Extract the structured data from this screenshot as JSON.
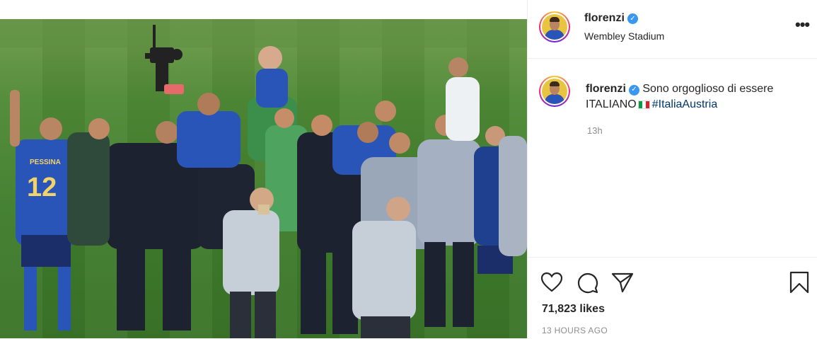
{
  "post": {
    "username": "florenzi",
    "location": "Wembley Stadium",
    "verified_badge": "✓",
    "more_icon": "•••",
    "caption_text": "Sono orgoglioso di essere ITALIANO",
    "caption_hashtag": "#ItaliaAustria",
    "caption_flag": "italy-flag",
    "time_relative": "13h",
    "likes": "71,823 likes",
    "time_ago": "13 HOURS AGO",
    "photo_alt": "Italy team celebrating at Wembley Stadium",
    "jersey_name": "PESSINA",
    "jersey_number": "12"
  },
  "colors": {
    "verified": "#3897f0",
    "hashtag": "#00376b",
    "muted": "#8e8e8e",
    "italy_blue": "#2a55b8",
    "pitch_green": "#4f8a36"
  },
  "icons": [
    "heart-icon",
    "comment-icon",
    "share-icon",
    "bookmark-icon",
    "verified-icon",
    "more-icon"
  ]
}
